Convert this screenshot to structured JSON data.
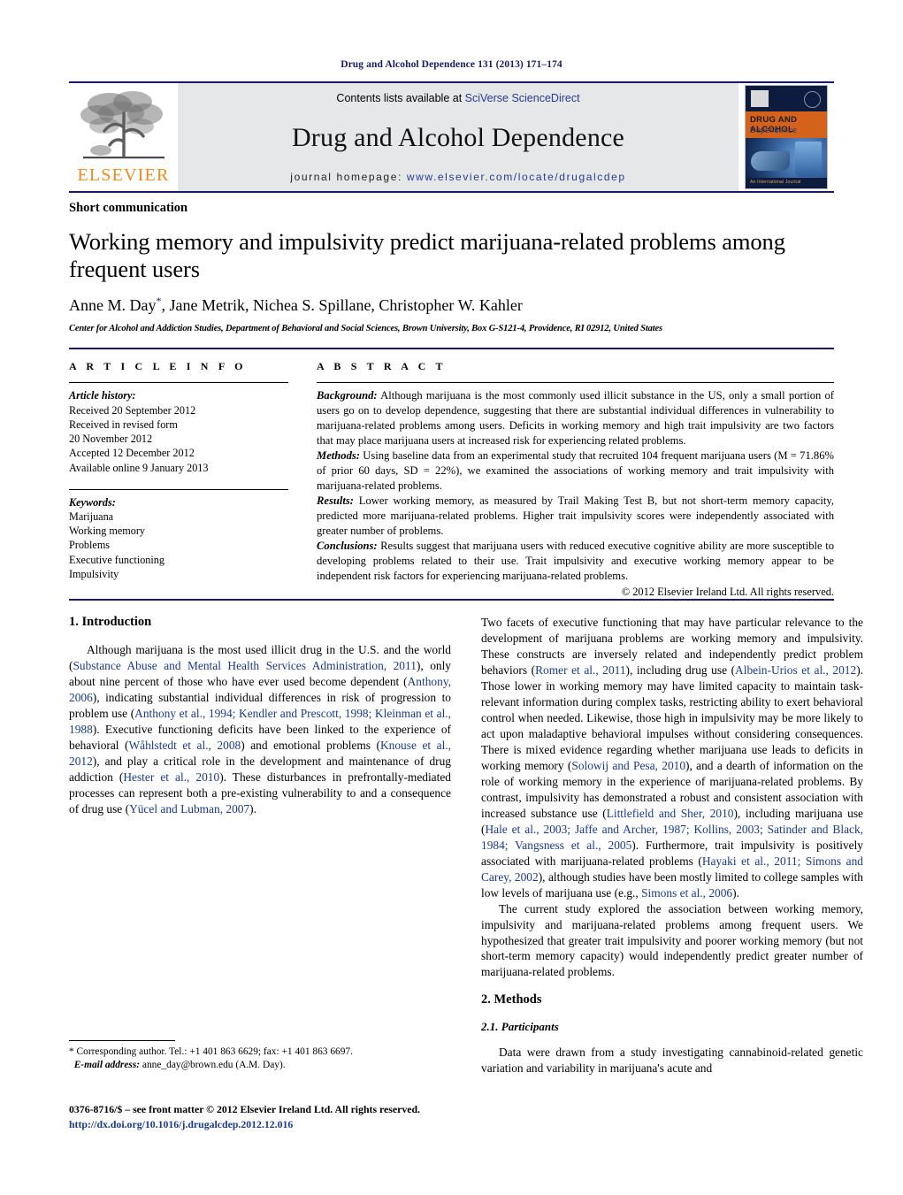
{
  "running_head": "Drug and Alcohol Dependence 131 (2013) 171–174",
  "masthead": {
    "contents_prefix": "Contents lists available at ",
    "contents_link": "SciVerse ScienceDirect",
    "journal_title": "Drug and Alcohol Dependence",
    "homepage_prefix": "journal homepage: ",
    "homepage_url": "www.elsevier.com/locate/drugalcdep",
    "publisher_wordmark": "ELSEVIER",
    "cover": {
      "title_line1": "DRUG AND ALCOHOL",
      "title_line2": "Dependence",
      "bottom_text": "An International Journal"
    }
  },
  "article": {
    "doc_type": "Short communication",
    "title": "Working memory and impulsivity predict marijuana-related problems among frequent users",
    "authors": "Anne M. Day, Jane Metrik, Nichea S. Spillane, Christopher W. Kahler",
    "author_marker": "*",
    "affiliation": "Center for Alcohol and Addiction Studies, Department of Behavioral and Social Sciences, Brown University, Box G-S121-4, Providence, RI 02912, United States"
  },
  "article_info": {
    "label": "A R T I C L E    I N F O",
    "history_heading": "Article history:",
    "history": [
      "Received 20 September 2012",
      "Received in revised form",
      "20 November 2012",
      "Accepted 12 December 2012",
      "Available online 9 January 2013"
    ],
    "keywords_heading": "Keywords:",
    "keywords": [
      "Marijuana",
      "Working memory",
      "Problems",
      "Executive functioning",
      "Impulsivity"
    ]
  },
  "abstract": {
    "label": "A B S T R A C T",
    "background_label": "Background:",
    "background_text": " Although marijuana is the most commonly used illicit substance in the US, only a small portion of users go on to develop dependence, suggesting that there are substantial individual differences in vulnerability to marijuana-related problems among users. Deficits in working memory and high trait impulsivity are two factors that may place marijuana users at increased risk for experiencing related problems.",
    "methods_label": "Methods:",
    "methods_text": " Using baseline data from an experimental study that recruited 104 frequent marijuana users (M = 71.86% of prior 60 days, SD = 22%), we examined the associations of working memory and trait impulsivity with marijuana-related problems.",
    "results_label": "Results:",
    "results_text": " Lower working memory, as measured by Trail Making Test B, but not short-term memory capacity, predicted more marijuana-related problems. Higher trait impulsivity scores were independently associated with greater number of problems.",
    "conclusions_label": "Conclusions:",
    "conclusions_text": " Results suggest that marijuana users with reduced executive cognitive ability are more susceptible to developing problems related to their use. Trait impulsivity and executive working memory appear to be independent risk factors for experiencing marijuana-related problems.",
    "copyright": "© 2012 Elsevier Ireland Ltd. All rights reserved."
  },
  "body": {
    "intro_heading": "1.  Introduction",
    "intro_p1_parts": [
      {
        "t": "Although marijuana is the most used illicit drug in the U.S. and the world (",
        "c": false
      },
      {
        "t": "Substance Abuse and Mental Health Services Administration, 2011",
        "c": true
      },
      {
        "t": "), only about nine percent of those who have ever used become dependent (",
        "c": false
      },
      {
        "t": "Anthony, 2006",
        "c": true
      },
      {
        "t": "), indicating substantial individual differences in risk of progression to problem use (",
        "c": false
      },
      {
        "t": "Anthony et al., 1994; Kendler and Prescott, 1998; Kleinman et al., 1988",
        "c": true
      },
      {
        "t": "). Executive functioning deficits have been linked to the experience of behavioral (",
        "c": false
      },
      {
        "t": "Wåhlstedt et al., 2008",
        "c": true
      },
      {
        "t": ") and emotional problems (",
        "c": false
      },
      {
        "t": "Knouse et al., 2012",
        "c": true
      },
      {
        "t": "), and play a critical role in the development and maintenance of drug addiction (",
        "c": false
      },
      {
        "t": "Hester et al., 2010",
        "c": true
      },
      {
        "t": "). These disturbances in prefrontally-mediated processes can represent both a pre-existing vulnerability to and a consequence of drug use (",
        "c": false
      },
      {
        "t": "Yücel and Lubman, 2007",
        "c": true
      },
      {
        "t": ").",
        "c": false
      }
    ],
    "intro_p2_parts": [
      {
        "t": "Two facets of executive functioning that may have particular relevance to the development of marijuana problems are working memory and impulsivity. These constructs are inversely related and independently predict problem behaviors (",
        "c": false
      },
      {
        "t": "Romer et al., 2011",
        "c": true
      },
      {
        "t": "), including drug use (",
        "c": false
      },
      {
        "t": "Albein-Urios et al., 2012",
        "c": true
      },
      {
        "t": "). Those lower in working memory may have limited capacity to maintain task-relevant information during complex tasks, restricting ability to exert behavioral control when needed. Likewise, those high in impulsivity may be more likely to act upon maladaptive behavioral impulses without considering consequences. There is mixed evidence regarding whether marijuana use leads to deficits in working memory (",
        "c": false
      },
      {
        "t": "Solowij and Pesa, 2010",
        "c": true
      },
      {
        "t": "), and a dearth of information on the role of working memory in the experience of marijuana-related problems. By contrast, impulsivity has demonstrated a robust and consistent association with increased substance use (",
        "c": false
      },
      {
        "t": "Littlefield and Sher, 2010",
        "c": true
      },
      {
        "t": "), including marijuana use (",
        "c": false
      },
      {
        "t": "Hale et al., 2003; Jaffe and Archer, 1987; Kollins, 2003; Satinder and Black, 1984; Vangsness et al., 2005",
        "c": true
      },
      {
        "t": "). Furthermore, trait impulsivity is positively associated with marijuana-related problems (",
        "c": false
      },
      {
        "t": "Hayaki et al., 2011; Simons and Carey, 2002",
        "c": true
      },
      {
        "t": "), although studies have been mostly limited to college samples with low levels of marijuana use (e.g., ",
        "c": false
      },
      {
        "t": "Simons et al., 2006",
        "c": true
      },
      {
        "t": ").",
        "c": false
      }
    ],
    "intro_p3_parts": [
      {
        "t": "The current study explored the association between working memory, impulsivity and marijuana-related problems among frequent users. We hypothesized that greater trait impulsivity and poorer working memory (but not short-term memory capacity) would independently predict greater number of marijuana-related problems.",
        "c": false
      }
    ],
    "methods_heading": "2.  Methods",
    "participants_heading": "2.1.  Participants",
    "participants_p1_parts": [
      {
        "t": "Data were drawn from a study investigating cannabinoid-related genetic variation and variability in marijuana's acute and",
        "c": false
      }
    ]
  },
  "footnote": {
    "marker": "*",
    "corresponding": " Corresponding author. Tel.: +1 401 863 6629; fax: +1 401 863 6697.",
    "email_label": "E-mail address:",
    "email": "anne_day@brown.edu",
    "email_suffix": " (A.M. Day)."
  },
  "imprint": {
    "line1": "0376-8716/$ – see front matter © 2012 Elsevier Ireland Ltd. All rights reserved.",
    "doi": "http://dx.doi.org/10.1016/j.drugalcdep.2012.12.016"
  }
}
